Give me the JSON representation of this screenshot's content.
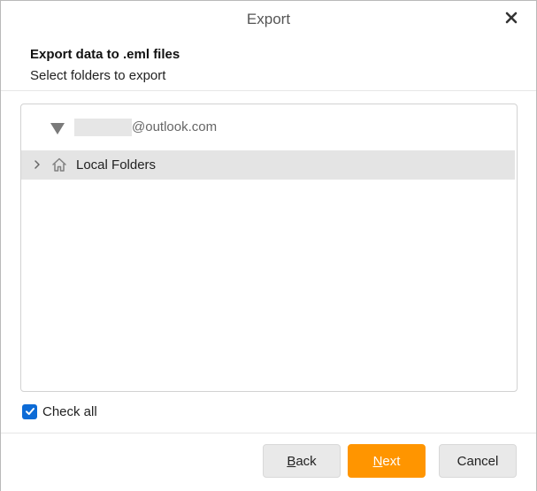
{
  "window": {
    "title": "Export",
    "close_icon": "close-icon"
  },
  "header": {
    "title": "Export data to .eml files",
    "subtitle": "Select folders to export"
  },
  "tree": {
    "account": {
      "label": "@outlook.com",
      "expand_icon": "triangle-down-icon"
    },
    "items": [
      {
        "label": "Local Folders",
        "icon": "home-icon",
        "expander": "chevron-right-icon"
      }
    ]
  },
  "check_all": {
    "label": "Check all",
    "checked": true
  },
  "buttons": {
    "back": {
      "accesskey": "B",
      "rest": "ack"
    },
    "next": {
      "accesskey": "N",
      "rest": "ext"
    },
    "cancel": "Cancel"
  },
  "colors": {
    "accent": "#ff9500",
    "checkbox": "#0d6bd6",
    "selected_row": "#e4e4e4"
  }
}
